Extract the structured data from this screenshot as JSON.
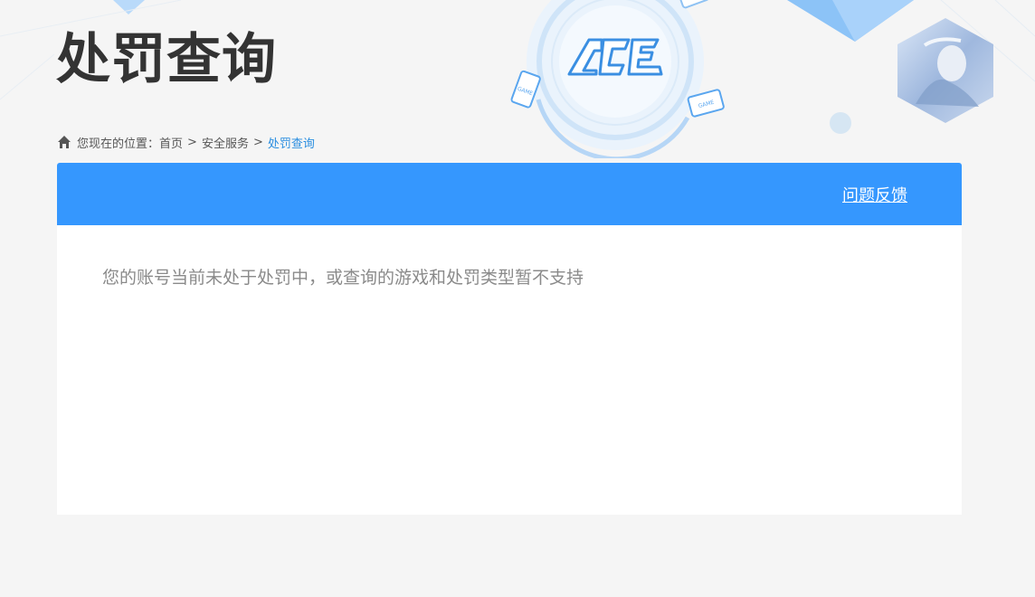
{
  "header": {
    "title": "处罚查询"
  },
  "breadcrumb": {
    "prefix": "您现在的位置：",
    "items": [
      "首页",
      "安全服务",
      "处罚查询"
    ],
    "separator": ">"
  },
  "card": {
    "feedback_link": "问题反馈",
    "result_message": "您的账号当前未处于处罚中，或查询的游戏和处罚类型暂不支持"
  },
  "colors": {
    "accent": "#3597fe",
    "title": "#333333",
    "breadcrumb_current": "#2a8ee0",
    "message": "#8a8a8a",
    "background": "#f5f5f5"
  },
  "icons": {
    "home": "home-icon",
    "logo": "ace-logo",
    "avatar": "character-avatar"
  }
}
